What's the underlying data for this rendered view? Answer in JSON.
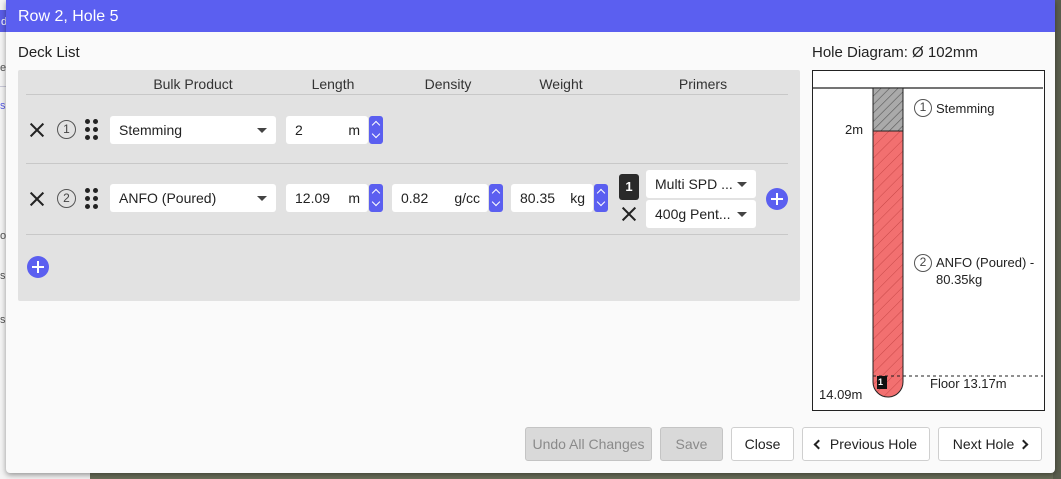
{
  "dialog": {
    "title": "Row 2, Hole 5"
  },
  "deck_list": {
    "title": "Deck List",
    "headers": {
      "bulk_product": "Bulk Product",
      "length": "Length",
      "density": "Density",
      "weight": "Weight",
      "primers": "Primers"
    },
    "rows": [
      {
        "index": "1",
        "product": "Stemming",
        "length": "2",
        "length_unit": "m"
      },
      {
        "index": "2",
        "product": "ANFO (Poured)",
        "length": "12.09",
        "length_unit": "m",
        "density": "0.82",
        "density_unit": "g/cc",
        "weight": "80.35",
        "weight_unit": "kg",
        "primer_count": "1",
        "primers": [
          "Multi SPD ...",
          "400g Pent..."
        ]
      }
    ]
  },
  "hole_diagram": {
    "title": "Hole Diagram: Ø 102mm",
    "stemming_label_num": "1",
    "stemming_label": "Stemming",
    "depth_2m": "2m",
    "anfo_label_num": "2",
    "anfo_label_line1": "ANFO (Poured) -",
    "anfo_label_line2": "80.35kg",
    "primer_marker": "1",
    "floor_label": "Floor 13.17m",
    "bottom_depth": "14.09m",
    "colors": {
      "stemming": "#aaaaaa",
      "anfo": "#f27070"
    }
  },
  "footer": {
    "undo": "Undo All Changes",
    "save": "Save",
    "close": "Close",
    "previous": "Previous Hole",
    "next": "Next Hole"
  },
  "background": {
    "letters": [
      "d",
      "e",
      "s",
      "ol",
      "s",
      "s"
    ]
  }
}
